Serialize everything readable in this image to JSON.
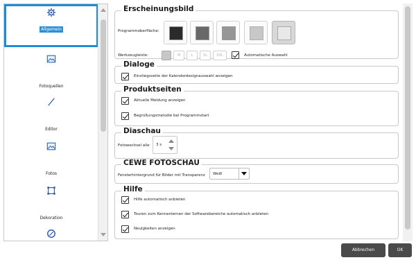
{
  "sidebar": {
    "items": [
      {
        "label": "Allgemein",
        "icon": "gear-icon"
      },
      {
        "label": "Fotoquellen",
        "icon": "image-icon"
      },
      {
        "label": "Editor",
        "icon": "pen-icon"
      },
      {
        "label": "Fotos",
        "icon": "image-icon"
      },
      {
        "label": "Dekoration",
        "icon": "frame-icon"
      },
      {
        "label": "",
        "icon": "compass-icon"
      }
    ]
  },
  "appearance": {
    "title": "Erscheinungsbild",
    "surface_label": "Programmoberfläche:",
    "toolbar_label": "Werkzeugleiste:",
    "sizes": [
      "M",
      "L",
      "XL",
      "XXL"
    ],
    "auto_label": "Automatische Auswahl",
    "swatch_colors": [
      "#2b2b2b",
      "#686868",
      "#969696",
      "#c8c8c8",
      "#e8e8e8"
    ]
  },
  "dialogs": {
    "title": "Dialoge",
    "calendar_label": "Einstiegsseite der Kalenderdesignauswahl anzeigen"
  },
  "product_pages": {
    "title": "Produktseiten",
    "current_notice_label": "Aktuelle Meldung anzeigen",
    "greeting_label": "Begrüßungsmelodie bei Programmstart"
  },
  "slideshow": {
    "title": "Diaschau",
    "interval_label": "Fotowechsel alle",
    "interval_value": "3 s"
  },
  "cewe": {
    "title": "CEWE FOTOSCHAU",
    "background_label": "Fensterhintergrund für Bilder mit Transparenz",
    "background_value": "Weiß"
  },
  "help": {
    "title": "Hilfe",
    "items": [
      "Hilfe automatisch anbieten",
      "Touren zum Kennenlernen der Softwarebereiche automatisch anbieten",
      "Neuigkeiten anzeigen"
    ]
  },
  "footer": {
    "cancel_label": "Abbrechen",
    "ok_label": "OK"
  }
}
